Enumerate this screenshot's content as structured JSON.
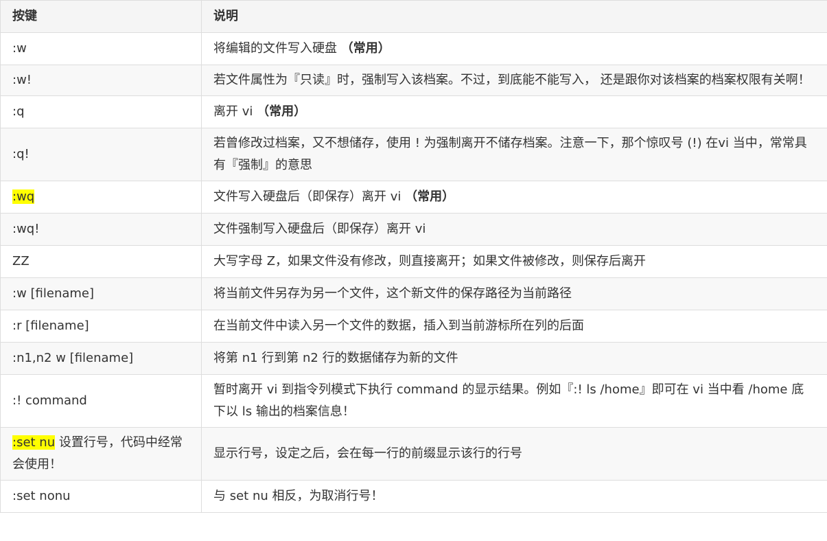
{
  "header": {
    "key": "按键",
    "desc": "说明"
  },
  "highlight_color": "#ffff00",
  "rows": [
    {
      "key": ":w",
      "desc": "将编辑的文件写入硬盘",
      "emph": "（常用）"
    },
    {
      "key": ":w!",
      "desc": "若文件属性为『只读』时，强制写入该档案。不过，到底能不能写入， 还是跟你对该档案的档案权限有关啊！"
    },
    {
      "key": ":q",
      "desc": "离开 vi",
      "emph": "（常用）"
    },
    {
      "key": ":q!",
      "desc": "若曾修改过档案，又不想储存，使用 ! 为强制离开不储存档案。注意一下，那个惊叹号 (!) 在vi 当中，常常具有『强制』的意思"
    },
    {
      "key": ":wq",
      "key_highlighted": true,
      "desc": "文件写入硬盘后（即保存）离开 vi",
      "emph": "（常用）"
    },
    {
      "key": ":wq!",
      "desc": "文件强制写入硬盘后（即保存）离开 vi"
    },
    {
      "key": "ZZ",
      "desc": "大写字母 Z，如果文件没有修改，则直接离开；如果文件被修改，则保存后离开"
    },
    {
      "key": ":w [filename]",
      "desc": "将当前文件另存为另一个文件，这个新文件的保存路径为当前路径"
    },
    {
      "key": ":r [filename]",
      "desc": "在当前文件中读入另一个文件的数据，插入到当前游标所在列的后面"
    },
    {
      "key": ":n1,n2 w [filename]",
      "desc": "将第 n1 行到第 n2 行的数据储存为新的文件"
    },
    {
      "key": ":! command",
      "desc": "暂时离开 vi 到指令列模式下执行 command 的显示结果。例如『:! ls /home』即可在 vi 当中看 /home 底下以 ls 输出的档案信息！"
    },
    {
      "key": ":set nu",
      "key_highlighted": true,
      "key_suffix": " 设置行号，代码中经常会使用！",
      "desc": "显示行号，设定之后，会在每一行的前缀显示该行的行号"
    },
    {
      "key": ":set nonu",
      "desc": "与 set nu 相反，为取消行号！"
    }
  ]
}
